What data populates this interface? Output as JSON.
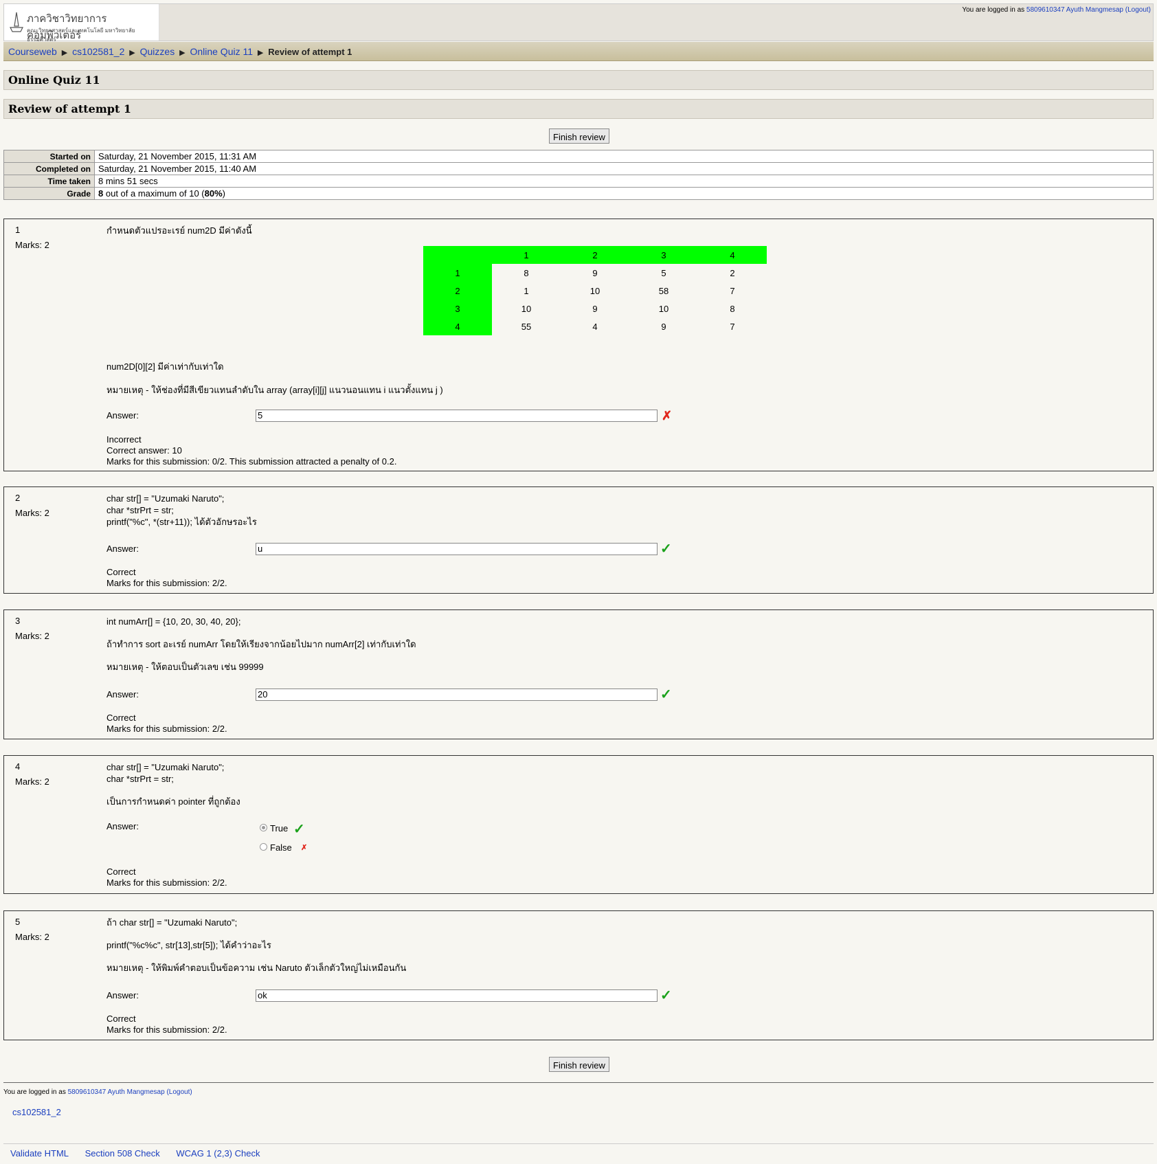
{
  "header": {
    "logo_line1": "ภาควิชาวิทยาการคอมพิวเตอร์",
    "logo_line2": "คณะวิทยาศาสตร์และเทคโนโลยี มหาวิทยาลัยธรรมศาสตร์",
    "login_prefix": "You are logged in as",
    "user_name": "5809610347 Ayuth Mangmesap",
    "logout_label": "(Logout)"
  },
  "breadcrumb": {
    "items": [
      "Courseweb",
      "cs102581_2",
      "Quizzes",
      "Online Quiz 11"
    ],
    "current": "Review of attempt 1"
  },
  "page": {
    "quiz_title": "Online Quiz 11",
    "review_title": "Review of attempt 1",
    "finish_review": "Finish review"
  },
  "summary": {
    "started_label": "Started on",
    "started_value": "Saturday, 21 November 2015, 11:31 AM",
    "completed_label": "Completed on",
    "completed_value": "Saturday, 21 November 2015, 11:40 AM",
    "time_label": "Time taken",
    "time_value": "8 mins 51 secs",
    "grade_label": "Grade",
    "grade_score": "8",
    "grade_mid": "out of a maximum of 10 (",
    "grade_pct": "80%",
    "grade_end": ")"
  },
  "questions": [
    {
      "number": "1",
      "marks": "Marks: 2",
      "text1": "กำหนดตัวแปรอะเรย์ num2D มีค่าดังนี้",
      "table_header": [
        "",
        "1",
        "2",
        "3",
        "4"
      ],
      "table_rows": [
        [
          "1",
          "8",
          "9",
          "5",
          "2"
        ],
        [
          "2",
          "1",
          "10",
          "58",
          "7"
        ],
        [
          "3",
          "10",
          "9",
          "10",
          "8"
        ],
        [
          "4",
          "55",
          "4",
          "9",
          "7"
        ]
      ],
      "text2": "num2D[0][2] มีค่าเท่ากับเท่าใด",
      "text3": "หมายเหตุ - ให้ช่องที่มีสีเขียวแทนลำดับใน array (array[i][j] แนวนอนแทน i แนวตั้งแทน j )",
      "answer_label": "Answer:",
      "answer_value": "5",
      "feedback1": "Incorrect",
      "feedback2": "Correct answer: 10",
      "feedback3": "Marks for this submission: 0/2. This submission attracted a penalty of 0.2."
    },
    {
      "number": "2",
      "marks": "Marks: 2",
      "line1": "char str[] = \"Uzumaki Naruto\";",
      "line2": "char *strPrt = str;",
      "line3": "printf(\"%c\", *(str+11)); ได้ตัวอักษรอะไร",
      "answer_label": "Answer:",
      "answer_value": "u",
      "feedback1": "Correct",
      "feedback2": "Marks for this submission: 2/2."
    },
    {
      "number": "3",
      "marks": "Marks: 2",
      "line1": "int numArr[] = {10, 20, 30, 40, 20};",
      "line2": "ถ้าทำการ sort อะเรย์ numArr โดยให้เรียงจากน้อยไปมาก numArr[2] เท่ากับเท่าใด",
      "line3": "หมายเหตุ - ให้ตอบเป็นตัวเลข เช่น 99999",
      "answer_label": "Answer:",
      "answer_value": "20",
      "feedback1": "Correct",
      "feedback2": "Marks for this submission: 2/2."
    },
    {
      "number": "4",
      "marks": "Marks: 2",
      "line1": "char str[] = \"Uzumaki Naruto\";",
      "line2": "char *strPrt = str;",
      "line3": "เป็นการกำหนดค่า pointer ที่ถูกต้อง",
      "answer_label": "Answer:",
      "option_true": "True",
      "option_false": "False",
      "feedback1": "Correct",
      "feedback2": "Marks for this submission: 2/2."
    },
    {
      "number": "5",
      "marks": "Marks: 2",
      "line1": "ถ้า char str[] = \"Uzumaki Naruto\";",
      "line2": "printf(\"%c%c\", str[13],str[5]); ได้คำว่าอะไร",
      "line3": "หมายเหตุ - ให้พิมพ์คำตอบเป็นข้อความ เช่น Naruto ตัวเล็กตัวใหญ่ไม่เหมือนกัน",
      "answer_label": "Answer:",
      "answer_value": "ok",
      "feedback1": "Correct",
      "feedback2": "Marks for this submission: 2/2."
    }
  ],
  "footer": {
    "course_link": "cs102581_2",
    "links": [
      "Validate HTML",
      "Section 508 Check",
      "WCAG 1 (2,3) Check"
    ]
  },
  "icons": {
    "correct": "check-icon",
    "incorrect": "cross-icon",
    "separator": "triangle-right-icon"
  },
  "colors": {
    "grid_header": "#00ff00",
    "correct": "#1aa11a",
    "incorrect": "#e0261c"
  }
}
